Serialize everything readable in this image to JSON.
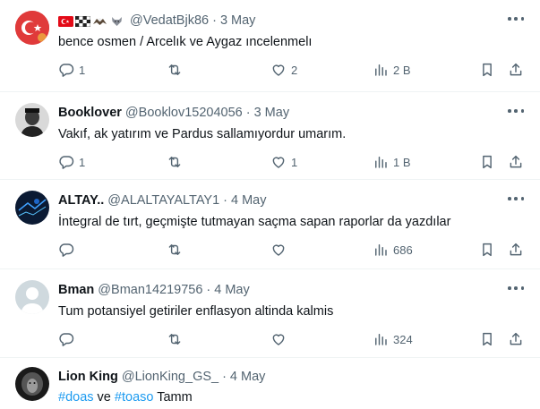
{
  "tweets": [
    {
      "name": "",
      "emoji_flags": [
        "turkey-flag-emoji",
        "checkered-flag-emoji",
        "eagle-emoji",
        "wolf-emoji"
      ],
      "handle": "@VedatBjk86",
      "date": "3 May",
      "text": "bence osmen / Arcelık ve Aygaz ıncelenmelı",
      "replies": "1",
      "retweets": "",
      "likes": "2",
      "views": "2 B"
    },
    {
      "name": "Booklover",
      "handle": "@Booklov15204056",
      "date": "3 May",
      "text": "Vakıf,  ak yatırım ve Pardus sallamıyordur umarım.",
      "replies": "1",
      "retweets": "",
      "likes": "1",
      "views": "1 B"
    },
    {
      "name": "ALTAY..",
      "handle": "@ALALTAYALTAY1",
      "date": "4 May",
      "text": "İntegral de tırt, geçmişte tutmayan saçma sapan raporlar da yazdılar",
      "replies": "",
      "retweets": "",
      "likes": "",
      "views": "686"
    },
    {
      "name": "Bman",
      "handle": "@Bman14219756",
      "date": "4 May",
      "text": "Tum potansiyel getiriler enflasyon altinda kalmis",
      "replies": "",
      "retweets": "",
      "likes": "",
      "views": "324"
    },
    {
      "name": "Lion King",
      "handle": "@LionKing_GS_",
      "date": "4 May",
      "hashtag1": "#doas",
      "conj": "ve",
      "hashtag2": "#toaso",
      "tail": "Tamm"
    }
  ],
  "sep": "·",
  "icons": {
    "reply": "reply-icon",
    "retweet": "retweet-icon",
    "like": "heart-icon",
    "views": "views-icon",
    "bookmark": "bookmark-icon",
    "share": "share-icon",
    "more": "more-icon"
  },
  "colors": {
    "link": "#1d9bf0",
    "muted": "#536471",
    "text": "#0f1419"
  }
}
